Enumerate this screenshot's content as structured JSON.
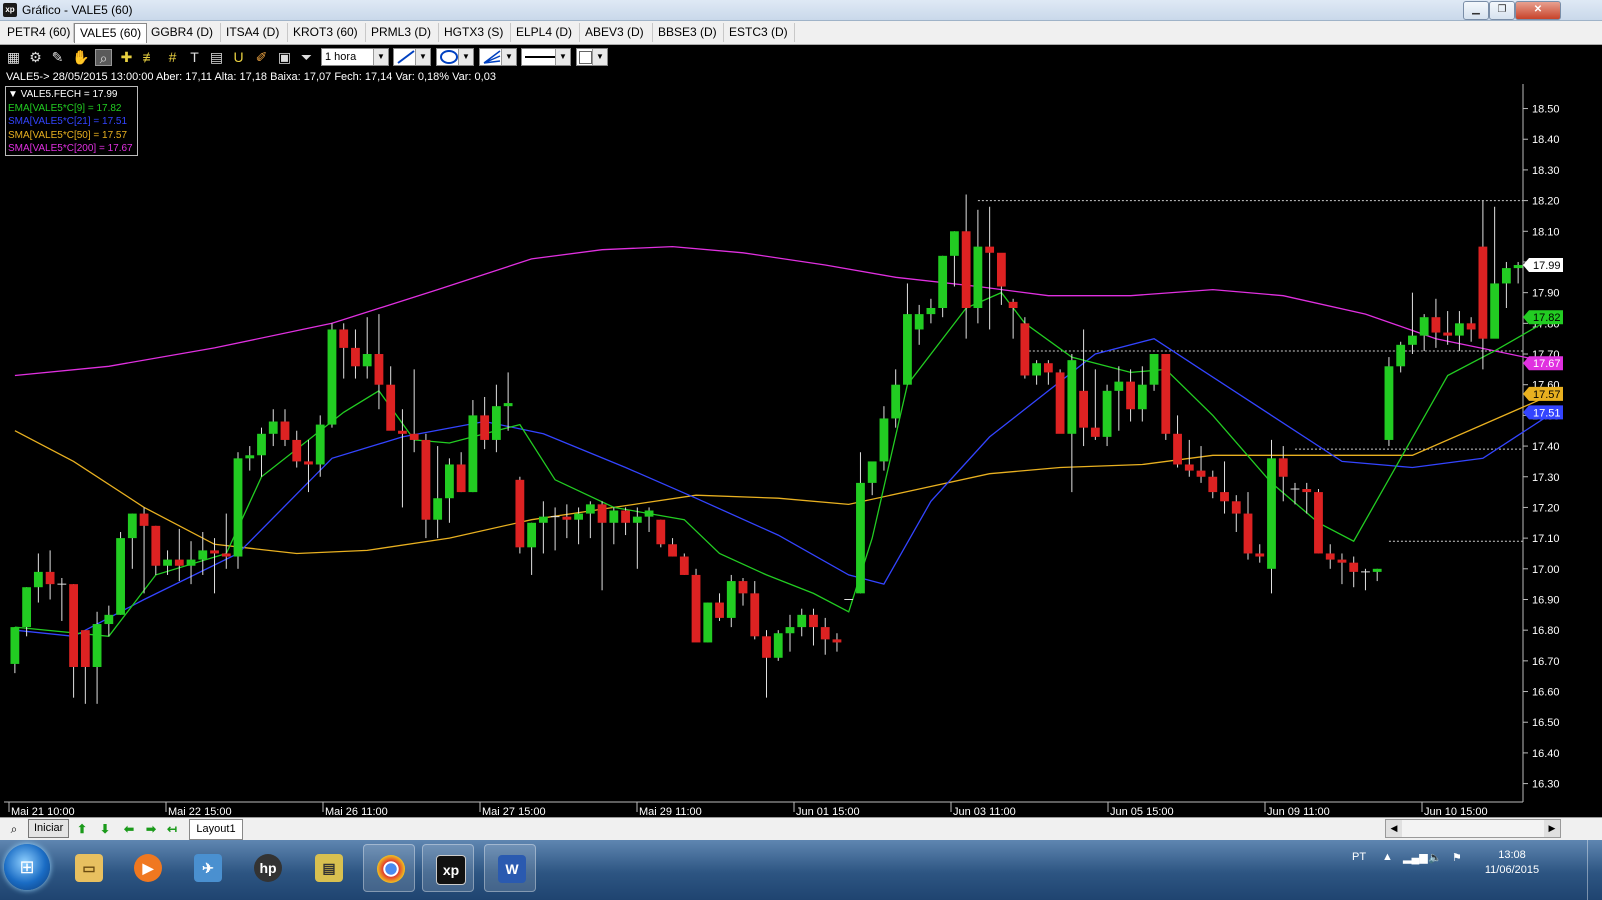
{
  "window": {
    "title": "Gráfico - VALE5 (60)",
    "app_icon": "xp"
  },
  "tabs": [
    "PETR4 (60)",
    "VALE5 (60)",
    "GGBR4 (D)",
    "ITSA4 (D)",
    "KROT3 (60)",
    "PRML3 (D)",
    "HGTX3 (S)",
    "ELPL4 (D)",
    "ABEV3 (D)",
    "BBSE3 (D)",
    "ESTC3 (D)"
  ],
  "active_tab": "VALE5 (60)",
  "toolbar": {
    "icons": [
      "chart-type-icon",
      "settings-gear-icon",
      "draw-trend-icon",
      "hand-pan-icon",
      "zoom-icon",
      "crosshair-icon",
      "fibonacci-icon",
      "grid-lines-icon",
      "text-tool-icon",
      "calculator-icon",
      "magnet-icon",
      "eraser-icon",
      "clipboard-icon",
      "filter-icon"
    ],
    "period": "1 hora"
  },
  "info_line": "VALE5-> 28/05/2015 13:00:00 Aber: 17,11 Alta: 17,18 Baixa: 17,07 Fech: 17,14 Var: 0,18% Var: 0,03",
  "legend": [
    {
      "text": "▼ VALE5.FECH = 17.99",
      "color": "#ffffff"
    },
    {
      "text": "EMA[VALE5*C[9] = 17.82",
      "color": "#22cc22"
    },
    {
      "text": "SMA[VALE5*C[21] = 17.51",
      "color": "#3344ff"
    },
    {
      "text": "SMA[VALE5*C[50] = 17.57",
      "color": "#e8b020"
    },
    {
      "text": "SMA[VALE5*C[200] = 17.67",
      "color": "#e030e0"
    }
  ],
  "colors": {
    "up": "#22cc22",
    "down": "#dd2222",
    "ema9": "#22cc22",
    "sma21": "#3344ff",
    "sma50": "#e8b020",
    "sma200": "#e030e0",
    "grid_dotted": "#cccccc"
  },
  "chart_data": {
    "type": "candlestick",
    "symbol": "VALE5",
    "ylim": [
      16.24,
      18.58
    ],
    "yticks": [
      16.3,
      16.4,
      16.5,
      16.6,
      16.7,
      16.8,
      16.9,
      17.0,
      17.1,
      17.2,
      17.3,
      17.4,
      17.5,
      17.6,
      17.7,
      17.8,
      17.9,
      18.0,
      18.1,
      18.2,
      18.3,
      18.4,
      18.5
    ],
    "xticks": [
      "Mai 21 10:00",
      "Mai 22 15:00",
      "Mai 26 11:00",
      "Mai 27 15:00",
      "Mai 29 11:00",
      "Jun 01 15:00",
      "Jun 03 11:00",
      "Jun 05 15:00",
      "Jun 09 11:00",
      "Jun 10 15:00"
    ],
    "badges": [
      {
        "label": "17.99",
        "value": 17.99,
        "color": "#ffffff",
        "text": "#000000"
      },
      {
        "label": "17.82",
        "value": 17.82,
        "color": "#22cc22",
        "text": "#000000"
      },
      {
        "label": "17.67",
        "value": 17.67,
        "color": "#e030e0",
        "text": "#ffffff"
      },
      {
        "label": "17.57",
        "value": 17.57,
        "color": "#e8b020",
        "text": "#000000"
      },
      {
        "label": "17.51",
        "value": 17.51,
        "color": "#3344ff",
        "text": "#ffffff"
      }
    ],
    "candles": [
      [
        16.69,
        16.81,
        16.66,
        16.81
      ],
      [
        16.81,
        16.94,
        16.78,
        16.94
      ],
      [
        16.94,
        17.05,
        16.89,
        16.99
      ],
      [
        16.99,
        17.06,
        16.9,
        16.95
      ],
      [
        16.95,
        16.97,
        16.83,
        16.95
      ],
      [
        16.95,
        16.95,
        16.58,
        16.68
      ],
      [
        16.8,
        16.8,
        16.56,
        16.68
      ],
      [
        16.68,
        16.86,
        16.56,
        16.82
      ],
      [
        16.82,
        16.88,
        16.78,
        16.85
      ],
      [
        16.85,
        17.12,
        16.85,
        17.1
      ],
      [
        17.1,
        17.18,
        17.0,
        17.18
      ],
      [
        17.18,
        17.2,
        16.92,
        17.14
      ],
      [
        17.14,
        17.14,
        16.98,
        17.01
      ],
      [
        17.01,
        17.06,
        16.98,
        17.03
      ],
      [
        17.03,
        17.13,
        16.96,
        17.01
      ],
      [
        17.01,
        17.09,
        16.95,
        17.03
      ],
      [
        17.03,
        17.12,
        16.98,
        17.06
      ],
      [
        17.06,
        17.1,
        16.92,
        17.05
      ],
      [
        17.05,
        17.18,
        17.0,
        17.04
      ],
      [
        17.04,
        17.38,
        17.0,
        17.36
      ],
      [
        17.36,
        17.4,
        17.32,
        17.37
      ],
      [
        17.37,
        17.46,
        17.3,
        17.44
      ],
      [
        17.44,
        17.52,
        17.4,
        17.48
      ],
      [
        17.48,
        17.52,
        17.4,
        17.42
      ],
      [
        17.42,
        17.45,
        17.33,
        17.35
      ],
      [
        17.35,
        17.42,
        17.25,
        17.34
      ],
      [
        17.34,
        17.5,
        17.3,
        17.47
      ],
      [
        17.47,
        17.8,
        17.46,
        17.78
      ],
      [
        17.78,
        17.8,
        17.62,
        17.72
      ],
      [
        17.72,
        17.78,
        17.62,
        17.66
      ],
      [
        17.66,
        17.82,
        17.62,
        17.7
      ],
      [
        17.7,
        17.83,
        17.52,
        17.6
      ],
      [
        17.6,
        17.66,
        17.46,
        17.45
      ],
      [
        17.45,
        17.52,
        17.2,
        17.44
      ],
      [
        17.44,
        17.65,
        17.38,
        17.42
      ],
      [
        17.42,
        17.44,
        17.1,
        17.16
      ],
      [
        17.16,
        17.4,
        17.1,
        17.23
      ],
      [
        17.23,
        17.36,
        17.15,
        17.34
      ],
      [
        17.34,
        17.38,
        17.25,
        17.25
      ],
      [
        17.25,
        17.55,
        17.25,
        17.5
      ],
      [
        17.5,
        17.56,
        17.39,
        17.42
      ],
      [
        17.42,
        17.6,
        17.38,
        17.53
      ],
      [
        17.53,
        17.64,
        17.45,
        17.54
      ],
      [
        17.29,
        17.3,
        17.05,
        17.07
      ],
      [
        17.07,
        17.15,
        16.98,
        17.15
      ],
      [
        17.15,
        17.22,
        17.05,
        17.17
      ],
      [
        17.17,
        17.2,
        17.06,
        17.17
      ],
      [
        17.17,
        17.21,
        17.1,
        17.16
      ],
      [
        17.16,
        17.2,
        17.08,
        17.18
      ],
      [
        17.18,
        17.22,
        17.1,
        17.21
      ],
      [
        17.21,
        17.22,
        16.93,
        17.15
      ],
      [
        17.15,
        17.2,
        17.08,
        17.19
      ],
      [
        17.19,
        17.2,
        17.11,
        17.15
      ],
      [
        17.15,
        17.2,
        17.0,
        17.17
      ],
      [
        17.17,
        17.2,
        17.12,
        17.19
      ],
      [
        17.16,
        17.16,
        17.07,
        17.08
      ],
      [
        17.08,
        17.1,
        17.04,
        17.04
      ],
      [
        17.04,
        17.05,
        16.98,
        16.98
      ],
      [
        16.98,
        17.0,
        16.77,
        16.76
      ],
      [
        16.76,
        16.89,
        16.76,
        16.89
      ],
      [
        16.89,
        16.92,
        16.83,
        16.84
      ],
      [
        16.84,
        16.98,
        16.81,
        16.96
      ],
      [
        16.96,
        16.97,
        16.88,
        16.92
      ],
      [
        16.92,
        16.96,
        16.77,
        16.78
      ],
      [
        16.78,
        16.8,
        16.58,
        16.71
      ],
      [
        16.71,
        16.8,
        16.7,
        16.79
      ],
      [
        16.79,
        16.85,
        16.73,
        16.81
      ],
      [
        16.81,
        16.87,
        16.78,
        16.85
      ],
      [
        16.85,
        16.87,
        16.75,
        16.81
      ],
      [
        16.81,
        16.84,
        16.72,
        16.77
      ],
      [
        16.77,
        16.79,
        16.73,
        16.76
      ],
      [
        16.9,
        16.9,
        16.9,
        16.9
      ],
      [
        16.92,
        17.38,
        16.92,
        17.28
      ],
      [
        17.28,
        17.32,
        17.24,
        17.35
      ],
      [
        17.35,
        17.53,
        17.32,
        17.49
      ],
      [
        17.49,
        17.65,
        17.46,
        17.6
      ],
      [
        17.6,
        17.93,
        17.6,
        17.83
      ],
      [
        17.78,
        17.86,
        17.73,
        17.83
      ],
      [
        17.83,
        17.88,
        17.8,
        17.85
      ],
      [
        17.85,
        18.02,
        17.82,
        18.02
      ],
      [
        18.02,
        18.1,
        17.92,
        18.1
      ],
      [
        18.1,
        18.22,
        17.75,
        17.85
      ],
      [
        17.85,
        18.17,
        17.8,
        18.05
      ],
      [
        18.05,
        18.18,
        17.78,
        18.03
      ],
      [
        18.03,
        18.02,
        17.86,
        17.92
      ],
      [
        17.87,
        17.88,
        17.75,
        17.85
      ],
      [
        17.8,
        17.82,
        17.62,
        17.63
      ],
      [
        17.63,
        17.68,
        17.6,
        17.67
      ],
      [
        17.67,
        17.68,
        17.6,
        17.64
      ],
      [
        17.64,
        17.65,
        17.45,
        17.44
      ],
      [
        17.44,
        17.7,
        17.25,
        17.68
      ],
      [
        17.58,
        17.78,
        17.4,
        17.46
      ],
      [
        17.46,
        17.65,
        17.42,
        17.43
      ],
      [
        17.43,
        17.6,
        17.4,
        17.58
      ],
      [
        17.58,
        17.66,
        17.45,
        17.61
      ],
      [
        17.61,
        17.65,
        17.48,
        17.52
      ],
      [
        17.52,
        17.66,
        17.48,
        17.6
      ],
      [
        17.6,
        17.7,
        17.58,
        17.7
      ],
      [
        17.7,
        17.68,
        17.42,
        17.44
      ],
      [
        17.44,
        17.5,
        17.33,
        17.34
      ],
      [
        17.34,
        17.42,
        17.3,
        17.32
      ],
      [
        17.32,
        17.4,
        17.28,
        17.3
      ],
      [
        17.3,
        17.32,
        17.23,
        17.25
      ],
      [
        17.25,
        17.35,
        17.18,
        17.22
      ],
      [
        17.22,
        17.24,
        17.12,
        17.18
      ],
      [
        17.18,
        17.25,
        17.03,
        17.05
      ],
      [
        17.05,
        17.08,
        17.02,
        17.04
      ],
      [
        17.0,
        17.42,
        16.92,
        17.36
      ],
      [
        17.36,
        17.4,
        17.22,
        17.3
      ],
      [
        17.26,
        17.28,
        17.21,
        17.26
      ],
      [
        17.26,
        17.28,
        17.18,
        17.25
      ],
      [
        17.25,
        17.26,
        17.05,
        17.05
      ],
      [
        17.05,
        17.08,
        17.0,
        17.03
      ],
      [
        17.03,
        17.05,
        16.95,
        17.02
      ],
      [
        17.02,
        17.04,
        16.94,
        16.99
      ],
      [
        16.99,
        17.0,
        16.93,
        16.99
      ],
      [
        16.99,
        17.0,
        16.96,
        17.0
      ],
      [
        17.42,
        17.69,
        17.4,
        17.66
      ],
      [
        17.66,
        17.74,
        17.64,
        17.73
      ],
      [
        17.73,
        17.9,
        17.7,
        17.76
      ],
      [
        17.76,
        17.83,
        17.71,
        17.82
      ],
      [
        17.82,
        17.88,
        17.72,
        17.77
      ],
      [
        17.77,
        17.84,
        17.73,
        17.76
      ],
      [
        17.76,
        17.84,
        17.71,
        17.8
      ],
      [
        17.8,
        17.82,
        17.74,
        17.78
      ],
      [
        18.05,
        18.2,
        17.65,
        17.75
      ],
      [
        17.75,
        18.18,
        17.76,
        17.93
      ],
      [
        17.93,
        18.0,
        17.85,
        17.98
      ],
      [
        17.98,
        18.0,
        17.93,
        17.99
      ]
    ],
    "ema9": [
      [
        0,
        16.81
      ],
      [
        8,
        16.78
      ],
      [
        12,
        16.98
      ],
      [
        18,
        17.05
      ],
      [
        21,
        17.3
      ],
      [
        28,
        17.51
      ],
      [
        31,
        17.58
      ],
      [
        34,
        17.42
      ],
      [
        37,
        17.41
      ],
      [
        40,
        17.44
      ],
      [
        43,
        17.47
      ],
      [
        46,
        17.29
      ],
      [
        51,
        17.2
      ],
      [
        57,
        17.16
      ],
      [
        60,
        17.05
      ],
      [
        64,
        16.98
      ],
      [
        68,
        16.92
      ],
      [
        71,
        16.86
      ],
      [
        73,
        17.1
      ],
      [
        76,
        17.6
      ],
      [
        81,
        17.85
      ],
      [
        84,
        17.9
      ],
      [
        86,
        17.8
      ],
      [
        90,
        17.69
      ],
      [
        95,
        17.64
      ],
      [
        98,
        17.65
      ],
      [
        102,
        17.5
      ],
      [
        107,
        17.28
      ],
      [
        111,
        17.15
      ],
      [
        114,
        17.09
      ],
      [
        118,
        17.36
      ],
      [
        122,
        17.63
      ],
      [
        126,
        17.71
      ],
      [
        131,
        17.82
      ]
    ],
    "sma21": [
      [
        0,
        16.8
      ],
      [
        5,
        16.78
      ],
      [
        11,
        16.9
      ],
      [
        19,
        17.05
      ],
      [
        27,
        17.36
      ],
      [
        33,
        17.43
      ],
      [
        40,
        17.48
      ],
      [
        45,
        17.44
      ],
      [
        52,
        17.33
      ],
      [
        58,
        17.23
      ],
      [
        65,
        17.11
      ],
      [
        71,
        16.98
      ],
      [
        74,
        16.95
      ],
      [
        78,
        17.22
      ],
      [
        83,
        17.43
      ],
      [
        88,
        17.58
      ],
      [
        92,
        17.7
      ],
      [
        97,
        17.75
      ],
      [
        101,
        17.65
      ],
      [
        107,
        17.5
      ],
      [
        113,
        17.35
      ],
      [
        119,
        17.33
      ],
      [
        125,
        17.36
      ],
      [
        131,
        17.51
      ]
    ],
    "sma50": [
      [
        0,
        17.45
      ],
      [
        5,
        17.35
      ],
      [
        11,
        17.2
      ],
      [
        17,
        17.08
      ],
      [
        24,
        17.05
      ],
      [
        30,
        17.06
      ],
      [
        37,
        17.1
      ],
      [
        44,
        17.16
      ],
      [
        51,
        17.2
      ],
      [
        58,
        17.24
      ],
      [
        65,
        17.23
      ],
      [
        71,
        17.21
      ],
      [
        77,
        17.26
      ],
      [
        83,
        17.31
      ],
      [
        89,
        17.33
      ],
      [
        96,
        17.34
      ],
      [
        102,
        17.37
      ],
      [
        108,
        17.37
      ],
      [
        114,
        17.37
      ],
      [
        119,
        17.37
      ],
      [
        125,
        17.47
      ],
      [
        131,
        17.57
      ]
    ],
    "sma200": [
      [
        0,
        17.63
      ],
      [
        8,
        17.66
      ],
      [
        17,
        17.72
      ],
      [
        27,
        17.8
      ],
      [
        36,
        17.91
      ],
      [
        44,
        18.01
      ],
      [
        50,
        18.04
      ],
      [
        56,
        18.05
      ],
      [
        62,
        18.03
      ],
      [
        69,
        17.99
      ],
      [
        75,
        17.95
      ],
      [
        82,
        17.92
      ],
      [
        88,
        17.89
      ],
      [
        95,
        17.89
      ],
      [
        102,
        17.91
      ],
      [
        108,
        17.89
      ],
      [
        115,
        17.83
      ],
      [
        121,
        17.75
      ],
      [
        126,
        17.71
      ],
      [
        131,
        17.67
      ]
    ],
    "levels": [
      {
        "y": 18.2,
        "from": 82,
        "to": 131
      },
      {
        "y": 17.71,
        "from": 86,
        "to": 131
      },
      {
        "y": 17.39,
        "from": 109,
        "to": 131
      },
      {
        "y": 17.09,
        "from": 117,
        "to": 131
      }
    ]
  },
  "bottom": {
    "start_label": "Iniciar",
    "layout_tab": "Layout1"
  },
  "taskbar": {
    "apps": [
      "file-explorer-icon",
      "media-player-icon",
      "messenger-icon",
      "hp-icon",
      "scanner-icon",
      "chrome-icon",
      "xp-icon",
      "word-icon"
    ],
    "language": "PT",
    "time": "13:08",
    "date": "11/06/2015"
  }
}
